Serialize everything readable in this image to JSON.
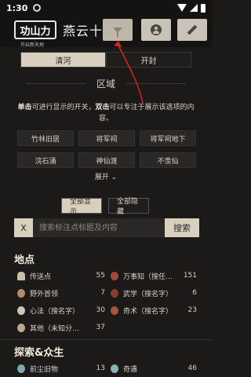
{
  "status_bar": {
    "time": "1:30"
  },
  "header": {
    "logo_text": "功山力",
    "logo_subtitle": "开启新天地",
    "app_title": "燕云十六声"
  },
  "region_tabs": [
    {
      "label": "清河",
      "active": true
    },
    {
      "label": "开封",
      "active": false
    }
  ],
  "area_section": {
    "title": "区域",
    "hint_bold_1": "单击",
    "hint_text_1": "可进行显示的开关，",
    "hint_bold_2": "双击",
    "hint_text_2": "可以专注于展示该选项的内容。",
    "chips": [
      [
        "竹林旧居",
        "将军祠",
        "将军祠地下"
      ],
      [
        "浣石涌",
        "神仙渡",
        "不羡仙"
      ]
    ],
    "expand_label": "展开"
  },
  "display_buttons": {
    "show_all": "全部显示",
    "hide_all": "全部隐藏"
  },
  "search": {
    "clear_label": "X",
    "placeholder": "搜索标注点标题及内容",
    "button_label": "搜索"
  },
  "categories": [
    {
      "title": "地点",
      "items": [
        {
          "icon": "teleport-icon",
          "label": "传送点",
          "count": "55"
        },
        {
          "icon": "wanshizhi-icon",
          "label": "万事知（搜任…",
          "count": "151"
        },
        {
          "icon": "boss-icon",
          "label": "野外首领",
          "count": "7"
        },
        {
          "icon": "wuxue-icon",
          "label": "武学（搜名字）",
          "count": "6"
        },
        {
          "icon": "xinfa-icon",
          "label": "心法（搜名字）",
          "count": "30"
        },
        {
          "icon": "qishu-icon",
          "label": "奇术（搜名字）",
          "count": "23"
        },
        {
          "icon": "other-icon",
          "label": "其他（未知分…",
          "count": "37"
        }
      ]
    },
    {
      "title": "探索&众生",
      "items": [
        {
          "icon": "relic-icon",
          "label": "前尘旧物",
          "count": "13"
        },
        {
          "icon": "encounter-icon",
          "label": "奇遇",
          "count": "46"
        }
      ]
    }
  ],
  "colors": {
    "background": "#1b1a19",
    "accent_light": "#d8cfbf",
    "annotation_red": "#e02020"
  }
}
